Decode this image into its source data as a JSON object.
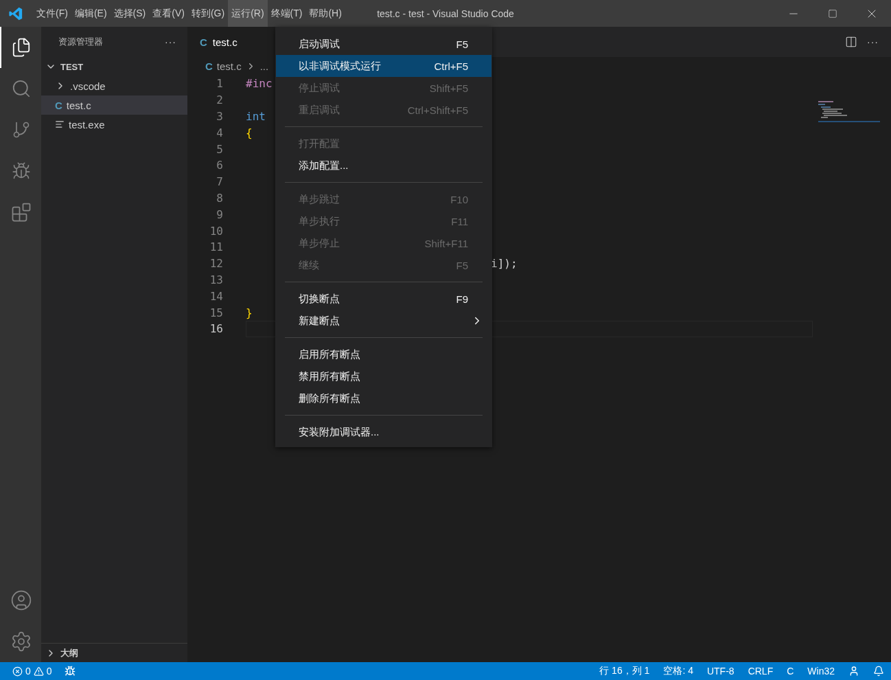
{
  "window": {
    "title": "test.c - test - Visual Studio Code"
  },
  "menubar": [
    {
      "label": "文件(F)",
      "selected": false
    },
    {
      "label": "编辑(E)",
      "selected": false
    },
    {
      "label": "选择(S)",
      "selected": false
    },
    {
      "label": "查看(V)",
      "selected": false
    },
    {
      "label": "转到(G)",
      "selected": false
    },
    {
      "label": "运行(R)",
      "selected": true
    },
    {
      "label": "终端(T)",
      "selected": false
    },
    {
      "label": "帮助(H)",
      "selected": false
    }
  ],
  "activity_bar": [
    {
      "kind": "files",
      "selected": true
    },
    {
      "kind": "search",
      "selected": false
    },
    {
      "kind": "git",
      "selected": false
    },
    {
      "kind": "debug",
      "selected": false
    },
    {
      "kind": "extensions",
      "selected": false
    }
  ],
  "sidebar": {
    "title": "资源管理器",
    "more": "···",
    "section": "TEST",
    "items": [
      {
        "kind": "folder",
        "label": ".vscode",
        "selected": false
      },
      {
        "kind": "c",
        "icon": "C",
        "label": "test.c",
        "selected": true
      },
      {
        "kind": "file",
        "label": "test.exe",
        "selected": false
      }
    ],
    "outline": "大纲"
  },
  "tabs": [
    {
      "icon": "C",
      "label": "test.c",
      "selected": true
    }
  ],
  "breadcrumb": {
    "icon": "C",
    "items": [
      "test.c",
      "..."
    ]
  },
  "code": [
    {
      "num": "1",
      "tokens": [
        {
          "kind": "directive",
          "text": "#inc"
        }
      ]
    },
    {
      "num": "2"
    },
    {
      "num": "3",
      "tokens": [
        {
          "kind": "type",
          "text": "int"
        }
      ]
    },
    {
      "num": "4",
      "tokens": [
        {
          "kind": "brace",
          "text": "{"
        }
      ]
    },
    {
      "num": "5"
    },
    {
      "num": "6"
    },
    {
      "num": "7"
    },
    {
      "num": "8"
    },
    {
      "num": "9"
    },
    {
      "num": "10"
    },
    {
      "num": "11"
    },
    {
      "num": "12",
      "tail": "i]);"
    },
    {
      "num": "13"
    },
    {
      "num": "14"
    },
    {
      "num": "15",
      "tokens": [
        {
          "kind": "brace",
          "text": "}"
        }
      ]
    },
    {
      "num": "16",
      "current": true
    }
  ],
  "menu": [
    {
      "kind": "item",
      "label": "启动调试",
      "shortcut": "F5",
      "disabled": false,
      "selected": false
    },
    {
      "kind": "item",
      "label": "以非调试模式运行",
      "shortcut": "Ctrl+F5",
      "disabled": false,
      "selected": true
    },
    {
      "kind": "item",
      "label": "停止调试",
      "shortcut": "Shift+F5",
      "disabled": true,
      "selected": false
    },
    {
      "kind": "item",
      "label": "重启调试",
      "shortcut": "Ctrl+Shift+F5",
      "disabled": true,
      "selected": false
    },
    {
      "kind": "separator"
    },
    {
      "kind": "item",
      "label": "打开配置",
      "disabled": true,
      "selected": false
    },
    {
      "kind": "item",
      "label": "添加配置...",
      "disabled": false,
      "selected": false
    },
    {
      "kind": "separator"
    },
    {
      "kind": "item",
      "label": "单步跳过",
      "shortcut": "F10",
      "disabled": true,
      "selected": false
    },
    {
      "kind": "item",
      "label": "单步执行",
      "shortcut": "F11",
      "disabled": true,
      "selected": false
    },
    {
      "kind": "item",
      "label": "单步停止",
      "shortcut": "Shift+F11",
      "disabled": true,
      "selected": false
    },
    {
      "kind": "item",
      "label": "继续",
      "shortcut": "F5",
      "disabled": true,
      "selected": false
    },
    {
      "kind": "separator"
    },
    {
      "kind": "item",
      "label": "切换断点",
      "shortcut": "F9",
      "disabled": false,
      "selected": false
    },
    {
      "kind": "submenu",
      "label": "新建断点",
      "disabled": false,
      "selected": false
    },
    {
      "kind": "separator"
    },
    {
      "kind": "item",
      "label": "启用所有断点",
      "disabled": false,
      "selected": false
    },
    {
      "kind": "item",
      "label": "禁用所有断点",
      "disabled": false,
      "selected": false
    },
    {
      "kind": "item",
      "label": "删除所有断点",
      "disabled": false,
      "selected": false
    },
    {
      "kind": "separator"
    },
    {
      "kind": "item",
      "label": "安装附加调试器...",
      "disabled": false,
      "selected": false
    }
  ],
  "status_bar": {
    "errors": "0",
    "warnings": "0",
    "right": [
      "行 16，列 1",
      "空格: 4",
      "UTF-8",
      "CRLF",
      "C",
      "Win32"
    ]
  }
}
